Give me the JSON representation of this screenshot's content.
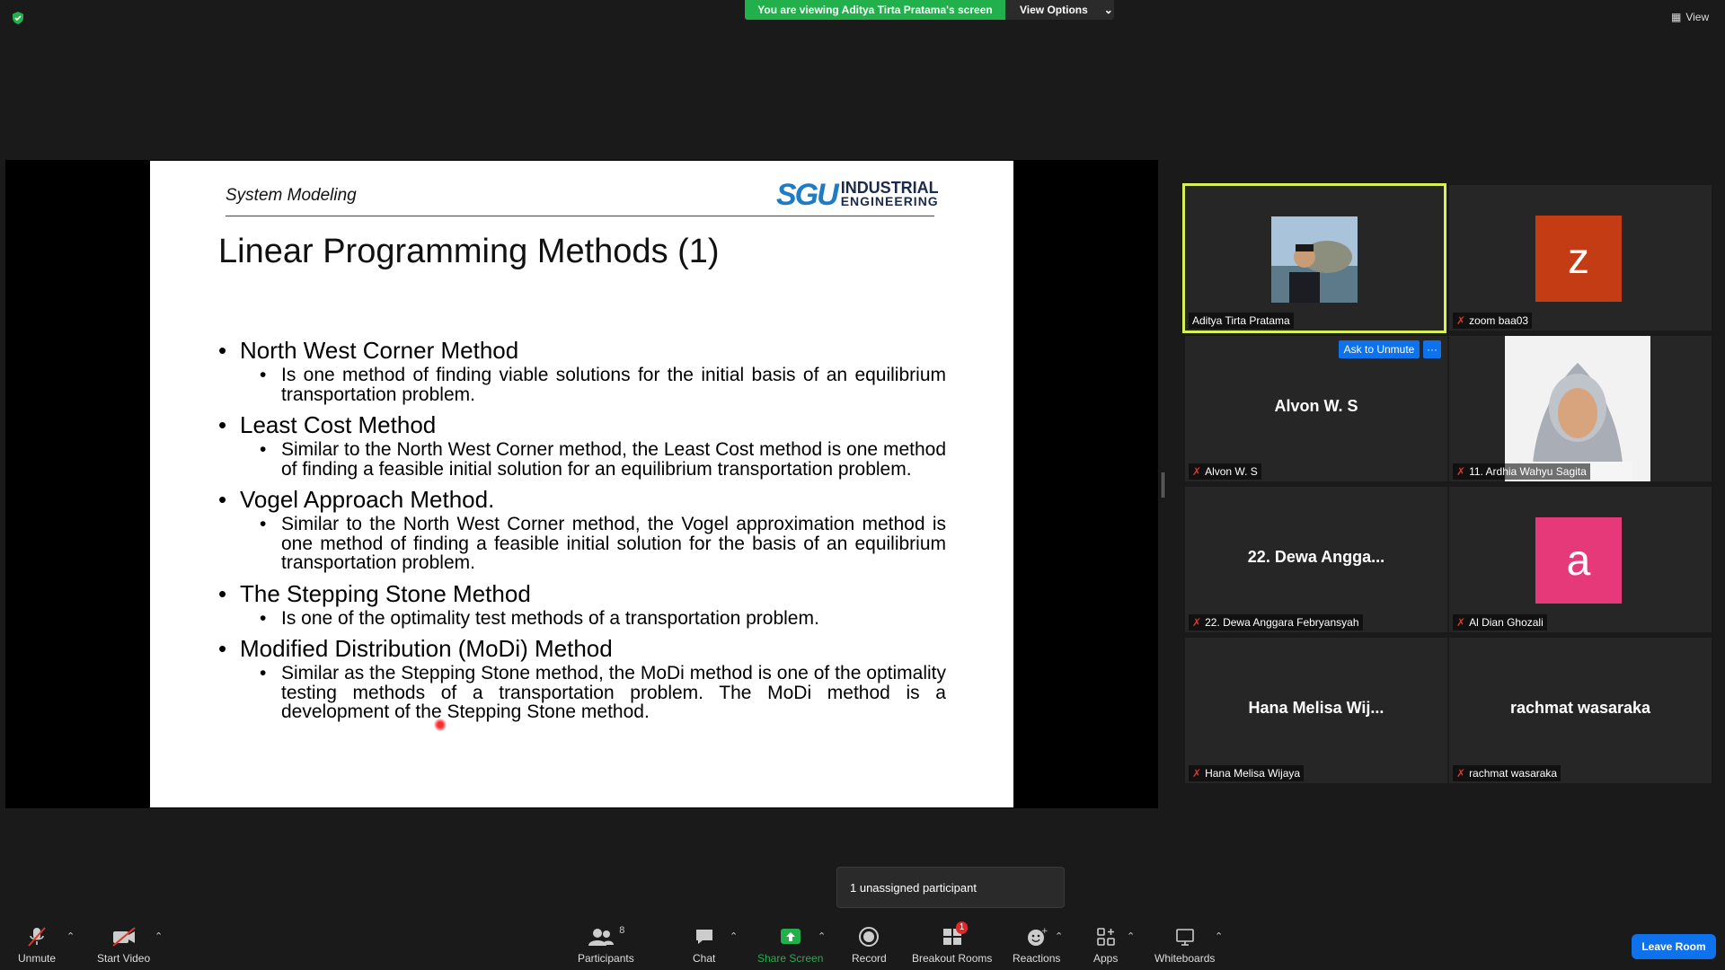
{
  "top": {
    "viewing_banner": "You are viewing Aditya Tirta Pratama's screen",
    "view_options": "View Options",
    "view_button": "View"
  },
  "slide": {
    "header": "System Modeling",
    "logo_mark": "SGU",
    "logo_line1": "INDUSTRIAL",
    "logo_line2": "ENGINEERING",
    "title": "Linear Programming Methods (1)",
    "items": [
      {
        "heading": "North West Corner Method",
        "detail": "Is one method of finding viable solutions for the initial basis of an equilibrium transportation problem."
      },
      {
        "heading": "Least Cost Method",
        "detail": "Similar to the North West Corner method, the Least Cost method is one method of finding a feasible initial solution for an equilibrium transportation problem."
      },
      {
        "heading": "Vogel Approach Method.",
        "detail": "Similar to the North West Corner method, the Vogel approximation method is one method of finding a feasible initial solution for the basis of an equilibrium transportation problem."
      },
      {
        "heading": "The Stepping Stone Method",
        "detail": "Is one of the optimality test methods of a transportation problem."
      },
      {
        "heading": "Modified Distribution (MoDi) Method",
        "detail": "Similar as the Stepping Stone method, the MoDi method is one of the optimality testing methods of a transportation problem. The MoDi method is a development of the Stepping Stone method."
      }
    ]
  },
  "gallery": {
    "tiles": [
      {
        "label": "Aditya Tirta Pratama",
        "big": ""
      },
      {
        "label": "zoom baa03",
        "big": "",
        "letter": "z",
        "letter_color": "#c33c13"
      },
      {
        "label": "Alvon W. S",
        "big": "Alvon W. S"
      },
      {
        "label": "11. Ardhia Wahyu Sagita",
        "big": ""
      },
      {
        "label": "22. Dewa Anggara Febryansyah",
        "big": "22. Dewa Angga..."
      },
      {
        "label": "Al Dian Ghozali",
        "big": "",
        "letter": "a",
        "letter_color": "#e5397a"
      },
      {
        "label": "Hana Melisa Wijaya",
        "big": "Hana Melisa Wij..."
      },
      {
        "label": "rachmat wasaraka",
        "big": "rachmat wasaraka"
      }
    ],
    "ask_unmute": "Ask to Unmute",
    "more": "···"
  },
  "popup": {
    "unassigned": "1 unassigned participant"
  },
  "toolbar": {
    "unmute": "Unmute",
    "start_video": "Start Video",
    "participants": "Participants",
    "participants_count": "8",
    "chat": "Chat",
    "share_screen": "Share Screen",
    "record": "Record",
    "breakout_rooms": "Breakout Rooms",
    "breakout_badge": "1",
    "reactions": "Reactions",
    "apps": "Apps",
    "whiteboards": "Whiteboards",
    "leave": "Leave Room"
  },
  "colors": {
    "accent": "#0e72ed",
    "share_green": "#21b04b",
    "active_border": "#d7f152"
  }
}
